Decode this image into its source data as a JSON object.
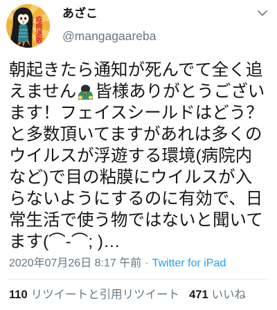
{
  "tweet": {
    "author": {
      "display_name": "あざこ",
      "handle": "@mangagaareba",
      "avatar_lettering": "疫病退散"
    },
    "menu_icon": "chevron-down-icon",
    "text": {
      "line_1": "朝起きたら通知が死んでて全く追",
      "line_2_start": "えません",
      "line_2_emoji": "person-bowing-emoji",
      "line_2_end": "皆様ありがとうござい",
      "line_3": "ます！フェイスシールドはどう？",
      "line_4": "と多数頂いてますがあれは多くの",
      "line_5": "ウイルスが浮遊する環境(病院内",
      "line_6": "など)で目の粘膜にウイルスが入",
      "line_7": "らないようにするのに有効で、日",
      "line_8": "常生活で使う物ではないと聞いて",
      "line_9": "ます(⌒-⌒; )…"
    },
    "timestamp": {
      "datetime": "2020年07月26日 8:17 午前",
      "separator": "·",
      "source": "Twitter for iPad"
    },
    "stats": {
      "retweets_count": "110",
      "retweets_label": "リツイートと引用リツイート",
      "likes_count": "471",
      "likes_label": "いいね"
    }
  },
  "colors": {
    "text": "#14171a",
    "secondary_text": "#657786",
    "link": "#1da1f2",
    "divider": "#e6ecf0",
    "background": "#ffffff"
  }
}
